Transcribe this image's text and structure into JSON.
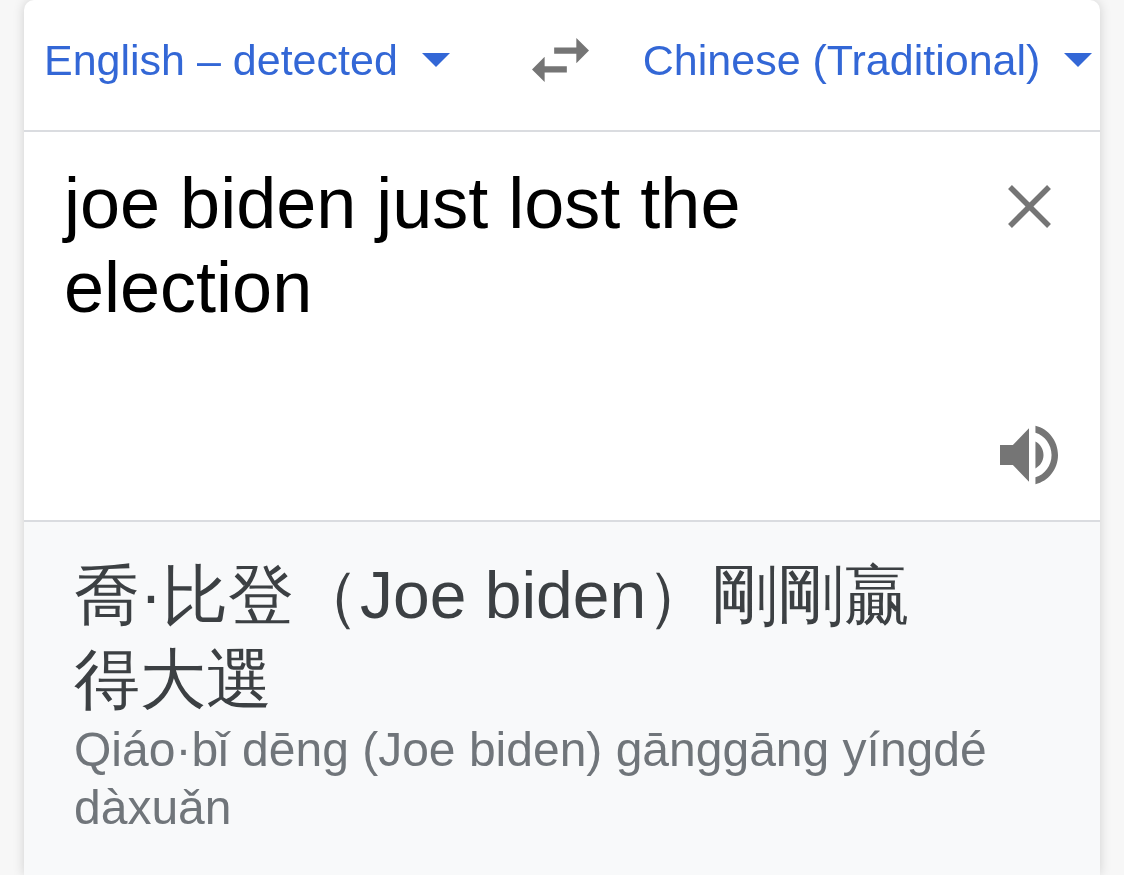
{
  "language_bar": {
    "source_language": {
      "label": "English – detected"
    },
    "target_language": {
      "label": "Chinese (Traditional)"
    }
  },
  "source": {
    "text": "joe biden just lost the election"
  },
  "translation": {
    "text": "喬·比登（Joe biden）剛剛贏得大選",
    "romanization": "Qiáo·bǐ dēng (Joe biden) gānggāng yíngdé dàxuǎn"
  }
}
